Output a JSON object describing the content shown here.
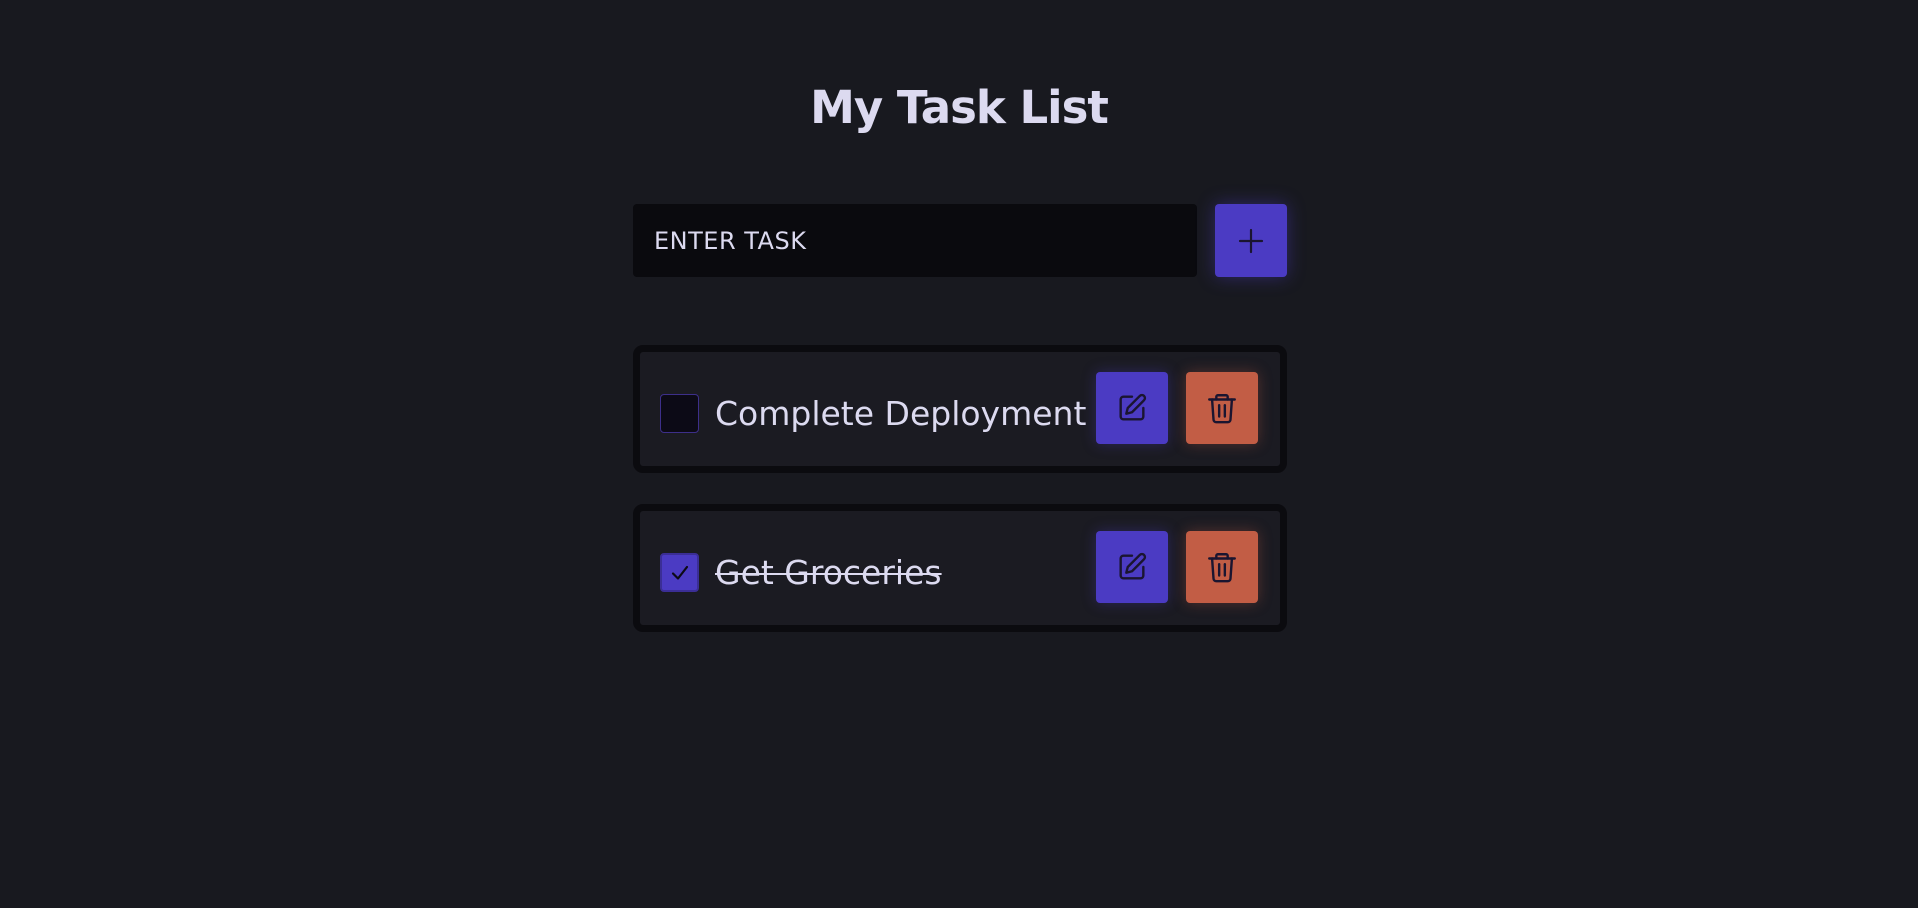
{
  "app": {
    "title": "My Task List"
  },
  "add_task": {
    "placeholder": "ENTER TASK",
    "value": "",
    "add_icon": "plus-icon"
  },
  "tasks": [
    {
      "text": "Complete Deployment",
      "completed": false,
      "edit_icon": "pencil-square-icon",
      "delete_icon": "trash-icon"
    },
    {
      "text": "Get Groceries",
      "completed": true,
      "check_icon": "checkmark-icon",
      "edit_icon": "pencil-square-icon",
      "delete_icon": "trash-icon"
    }
  ],
  "colors": {
    "background": "#18191f",
    "accent": "#4b3bc3",
    "danger": "#c25d45",
    "text": "#dcdaf0"
  }
}
